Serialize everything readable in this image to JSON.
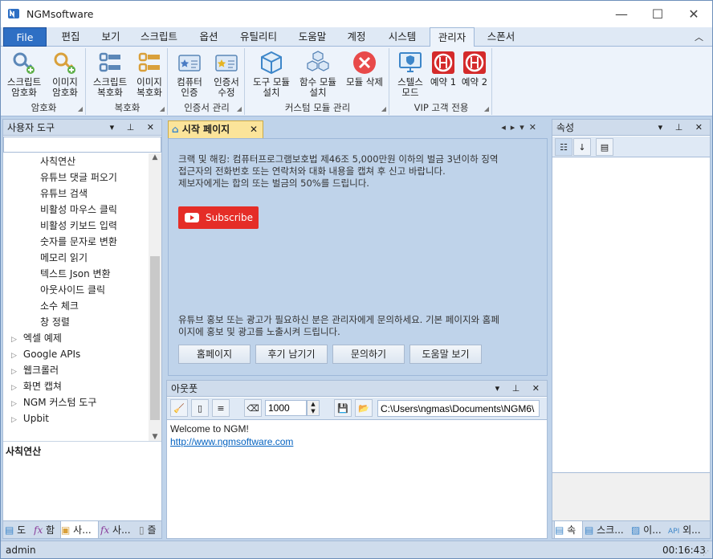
{
  "window": {
    "title": "NGMsoftware",
    "status_user": "admin",
    "status_time": "00:16:43"
  },
  "menu": {
    "file": "File",
    "tabs": [
      "편집",
      "보기",
      "스크립트",
      "옵션",
      "유틸리티",
      "도움말",
      "계정",
      "시스템",
      "관리자",
      "스폰서"
    ],
    "active_tab": "관리자"
  },
  "ribbon": {
    "groups": [
      {
        "label": "암호화",
        "buttons": [
          {
            "label": "스크립트\n암호화",
            "icon": "key-script-icon"
          },
          {
            "label": "이미지\n암호화",
            "icon": "key-image-icon"
          }
        ]
      },
      {
        "label": "복호화",
        "buttons": [
          {
            "label": "스크립트\n복호화",
            "icon": "unlock-script-icon"
          },
          {
            "label": "이미지\n복호화",
            "icon": "unlock-image-icon"
          }
        ]
      },
      {
        "label": "인증서 관리",
        "buttons": [
          {
            "label": "컴퓨터\n인증",
            "icon": "certificate-icon"
          },
          {
            "label": "인증서\n수정",
            "icon": "certificate-edit-icon"
          }
        ]
      },
      {
        "label": "커스텀 모듈 관리",
        "buttons": [
          {
            "label": "도구 모듈\n설치",
            "icon": "module-box-icon"
          },
          {
            "label": "함수 모듈\n설치",
            "icon": "module-cubes-icon"
          },
          {
            "label": "모듈 삭제",
            "icon": "delete-icon"
          }
        ]
      },
      {
        "label": "VIP 고객 전용",
        "buttons": [
          {
            "label": "스텔스\n모드",
            "icon": "monitor-shield-icon"
          },
          {
            "label": "예약 1",
            "icon": "reserve-icon"
          },
          {
            "label": "예약 2",
            "icon": "reserve-icon"
          }
        ]
      }
    ]
  },
  "left_panel": {
    "title": "사용자 도구",
    "search_value": "",
    "children": [
      "사칙연산",
      "유튜브 댓글 퍼오기",
      "유튜브 검색",
      "비활성 마우스 클릭",
      "비활성 키보드 입력",
      "숫자를 문자로 변환",
      "메모리 읽기",
      "텍스트 Json 변환",
      "아웃사이드 클릭",
      "소수 체크",
      "창 정렬"
    ],
    "folders": [
      "엑셀 예제",
      "Google APIs",
      "웹크롤러",
      "화면 캡쳐",
      "NGM 커스텀 도구",
      "Upbit"
    ],
    "selected_label": "사칙연산",
    "bottom_tabs": [
      "도",
      "함",
      "사...",
      "사...",
      "즐"
    ]
  },
  "start_page": {
    "tab_title": "시작 페이지",
    "warning": "크랙 및 해킹: 컴퓨터프로그램보호법 제46조 5,000만원 이하의 벌금 3년이하 징역\n접근자의 전화번호 또는 연락처와 대화 내용을 캡쳐 후 신고 바랍니다.\n제보자에게는 합의 또는 벌금의 50%를 드립니다.",
    "subscribe": "Subscribe",
    "promo": "유튜브 홍보 또는 광고가 필요하신 분은 관리자에게 문의하세요. 기본 페이지와 홈페\n이지에 홍보 및 광고를 노출시켜 드립니다.",
    "buttons": [
      "홈페이지",
      "후기 남기기",
      "문의하기",
      "도움말 보기"
    ]
  },
  "output": {
    "title": "아웃풋",
    "count": "1000",
    "path": "C:\\Users\\ngmas\\Documents\\NGM6\\",
    "welcome": "Welcome to NGM!",
    "link": "http://www.ngmsoftware.com"
  },
  "props": {
    "title": "속성",
    "bottom_tabs": [
      "속",
      "스크...",
      "이...",
      "외..."
    ]
  }
}
